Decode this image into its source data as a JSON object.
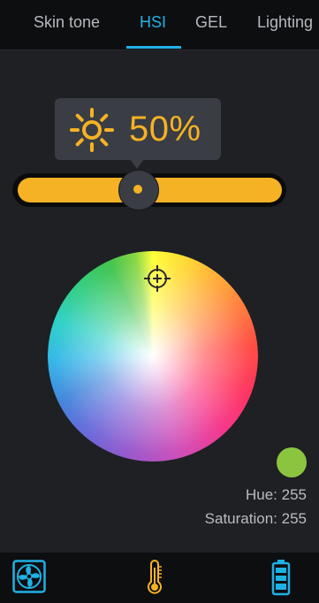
{
  "tabs": [
    {
      "label": "Skin tone"
    },
    {
      "label": "HSI"
    },
    {
      "label": "GEL"
    },
    {
      "label": "Lighting"
    }
  ],
  "active_tab": "HSI",
  "brightness": {
    "value_text": "50%",
    "level_percent": 50,
    "icon": "sun-icon"
  },
  "colors": {
    "accent": "#1fb1e6",
    "brightness": "#f5b224",
    "selected_color": "#8bc540"
  },
  "color_wheel": {
    "icon": "crosshair-icon"
  },
  "readout": {
    "hue_label": "Hue:",
    "hue_value": "255",
    "saturation_label": "Saturation:",
    "saturation_value": "255"
  },
  "bottom_bar": {
    "icons": [
      "fan-icon",
      "thermometer-icon",
      "battery-icon"
    ]
  }
}
